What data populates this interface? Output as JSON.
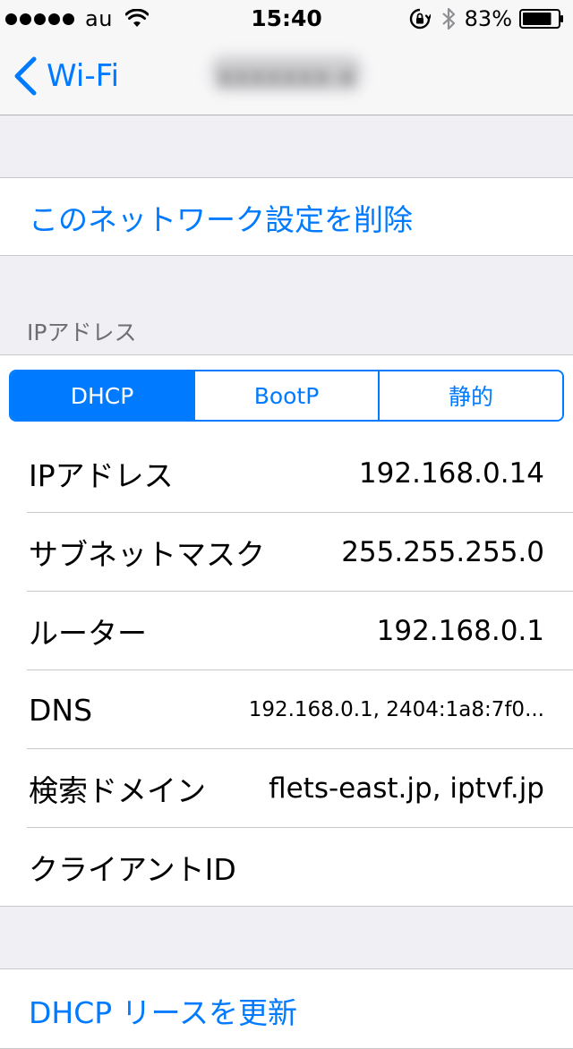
{
  "status_bar": {
    "carrier": "au",
    "time": "15:40",
    "battery_percent": "83%",
    "battery_level": 0.83,
    "signal_bars": 5
  },
  "nav": {
    "back_label": "Wi-Fi",
    "title": "xxxxxxx-x"
  },
  "actions": {
    "forget_network": "このネットワーク設定を削除",
    "renew_lease": "DHCP リースを更新"
  },
  "ip_section": {
    "header": "IPアドレス",
    "segments": [
      {
        "label": "DHCP",
        "selected": true
      },
      {
        "label": "BootP",
        "selected": false
      },
      {
        "label": "静的",
        "selected": false
      }
    ],
    "rows": [
      {
        "label": "IPアドレス",
        "value": "192.168.0.14"
      },
      {
        "label": "サブネットマスク",
        "value": "255.255.255.0"
      },
      {
        "label": "ルーター",
        "value": "192.168.0.1"
      },
      {
        "label": "DNS",
        "value": "192.168.0.1, 2404:1a8:7f0..."
      },
      {
        "label": "検索ドメイン",
        "value": "flets-east.jp, iptvf.jp"
      },
      {
        "label": "クライアントID",
        "value": ""
      }
    ]
  },
  "colors": {
    "accent": "#007aff",
    "background": "#efeff4",
    "separator": "#c8c7cc",
    "section_header": "#6d6d72"
  },
  "icons": {
    "back": "chevron-left-icon",
    "wifi": "wifi-icon",
    "rotation_lock": "rotation-lock-icon",
    "bluetooth": "bluetooth-icon",
    "battery": "battery-icon"
  }
}
